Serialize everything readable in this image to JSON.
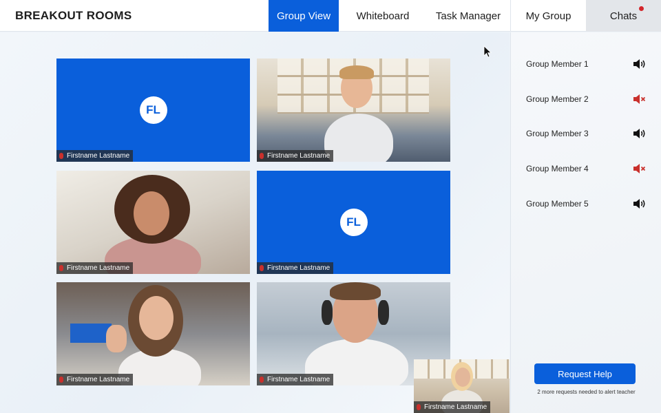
{
  "app": {
    "title": "BREAKOUT ROOMS"
  },
  "tabs": [
    {
      "label": "Group View",
      "active": true
    },
    {
      "label": "Whiteboard"
    },
    {
      "label": "Task Manager"
    },
    {
      "label": "My Group"
    },
    {
      "label": "Chats",
      "notification": true
    }
  ],
  "tiles": [
    {
      "type": "avatar",
      "initials": "FL",
      "name": "Firstname Lastname",
      "muted": true
    },
    {
      "type": "video",
      "name": "Firstname Lastname",
      "muted": true
    },
    {
      "type": "video",
      "name": "Firstname Lastname",
      "muted": true
    },
    {
      "type": "avatar",
      "initials": "FL",
      "name": "Firstname Lastname",
      "muted": true
    },
    {
      "type": "video",
      "name": "Firstname Lastname",
      "muted": true
    },
    {
      "type": "video",
      "name": "Firstname Lastname",
      "muted": true
    }
  ],
  "self_view": {
    "name": "Firstname Lastname",
    "muted": true
  },
  "group_members": [
    {
      "name": "Group Member 1",
      "audio": "speaker-on-icon"
    },
    {
      "name": "Group Member 2",
      "audio": "speaker-muted-icon"
    },
    {
      "name": "Group Member 3",
      "audio": "speaker-on-icon"
    },
    {
      "name": "Group Member 4",
      "audio": "speaker-muted-icon"
    },
    {
      "name": "Group Member 5",
      "audio": "speaker-on-icon"
    }
  ],
  "request_help": {
    "label": "Request Help",
    "note": "2 more requests needed to alert teacher"
  },
  "colors": {
    "accent": "#0a5fdb",
    "muted": "#c9302c",
    "notification": "#d3262c"
  }
}
